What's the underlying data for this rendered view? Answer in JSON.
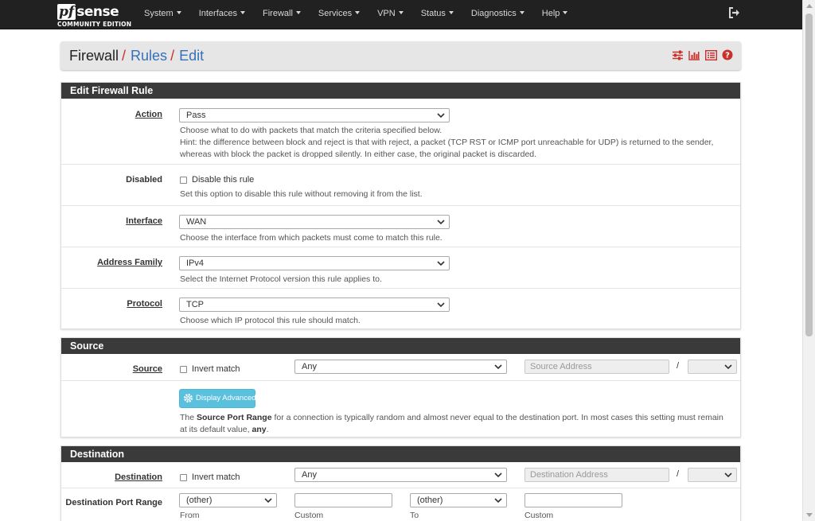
{
  "navbar": {
    "brand_pf": "pf",
    "brand_sense": "sense",
    "brand_edition": "COMMUNITY EDITION",
    "items": [
      {
        "label": "System"
      },
      {
        "label": "Interfaces"
      },
      {
        "label": "Firewall"
      },
      {
        "label": "Services"
      },
      {
        "label": "VPN"
      },
      {
        "label": "Status"
      },
      {
        "label": "Diagnostics"
      },
      {
        "label": "Help"
      }
    ],
    "logout_icon": "sign-out-icon"
  },
  "breadcrumb": {
    "root": "Firewall",
    "sep": "/",
    "items": [
      "Rules",
      "Edit"
    ],
    "icons": [
      "sliders-icon",
      "bar-chart-icon",
      "list-icon",
      "question-circle-icon"
    ],
    "icon_color": "#c9302c"
  },
  "edit_rule": {
    "heading": "Edit Firewall Rule",
    "action": {
      "label": "Action",
      "value": "Pass",
      "help1": "Choose what to do with packets that match the criteria specified below.",
      "help2": "Hint: the difference between block and reject is that with reject, a packet (TCP RST or ICMP port unreachable for UDP) is returned to the sender, whereas with block the packet is dropped silently. In either case, the original packet is discarded."
    },
    "disabled": {
      "label": "Disabled",
      "checkbox_label": "Disable this rule",
      "help": "Set this option to disable this rule without removing it from the list."
    },
    "interface": {
      "label": "Interface",
      "value": "WAN",
      "help": "Choose the interface from which packets must come to match this rule."
    },
    "address_family": {
      "label": "Address Family",
      "value": "IPv4",
      "help": "Select the Internet Protocol version this rule applies to."
    },
    "protocol": {
      "label": "Protocol",
      "value": "TCP",
      "help": "Choose which IP protocol this rule should match."
    }
  },
  "source": {
    "heading": "Source",
    "label": "Source",
    "invert_label": "Invert match",
    "type_value": "Any",
    "address_placeholder": "Source Address",
    "mask_sep": "/",
    "advanced_button": "Display Advanced",
    "help_pre": "The ",
    "help_bold": "Source Port Range",
    "help_mid": " for a connection is typically random and almost never equal to the destination port. In most cases this setting must remain at its default value, ",
    "help_bold2": "any",
    "help_post": "."
  },
  "destination": {
    "heading": "Destination",
    "label": "Destination",
    "invert_label": "Invert match",
    "type_value": "Any",
    "address_placeholder": "Destination Address",
    "mask_sep": "/",
    "port_range_label": "Destination Port Range",
    "from_value": "(other)",
    "to_value": "(other)",
    "sub_from": "From",
    "sub_custom1": "Custom",
    "sub_to": "To",
    "sub_custom2": "Custom"
  },
  "colors": {
    "navbar": "#212121",
    "panel_heading": "#3a3a3a",
    "link": "#3571b8",
    "accent": "#c9302c",
    "info_button": "#5bc0de"
  }
}
